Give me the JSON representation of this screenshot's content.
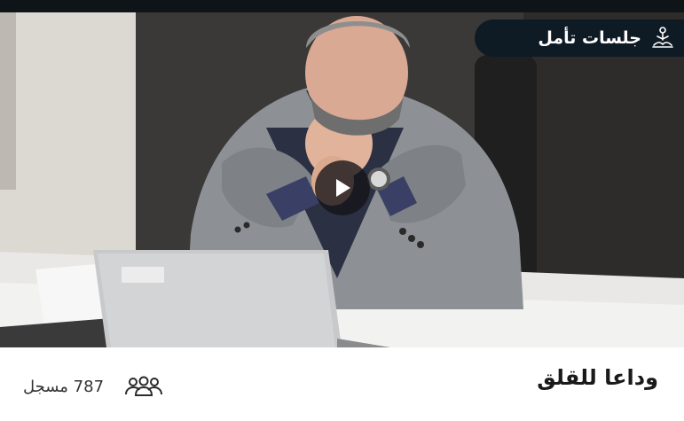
{
  "category": {
    "label": "جلسات تأمل",
    "icon": "meditation-icon"
  },
  "media": {
    "play_icon": "play-icon",
    "scene": "thoughtful-man-at-laptop"
  },
  "course": {
    "title": "وداعا للقلق",
    "enrolled_text": "787 مسجل",
    "enrolled_icon": "people-icon"
  },
  "colors": {
    "badge_bg": "#0e1a24",
    "text_dark": "#1a1a1a",
    "top_strip": "#0f1418"
  }
}
